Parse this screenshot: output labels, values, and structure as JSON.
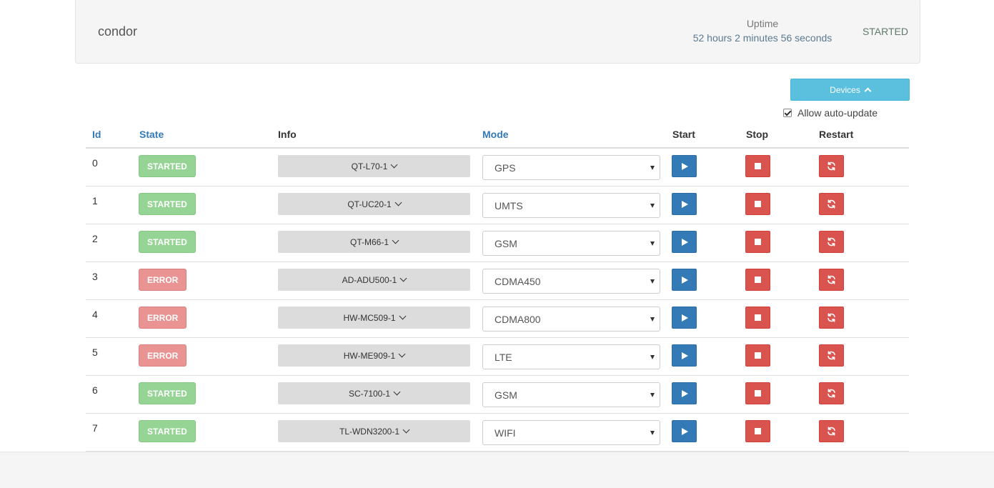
{
  "header": {
    "name": "condor",
    "uptime_label": "Uptime",
    "uptime_value": "52 hours 2 minutes 56 seconds",
    "status": "STARTED"
  },
  "controls": {
    "devices_label": "Devices",
    "auto_update_label": "Allow auto-update",
    "auto_update_checked": true
  },
  "table": {
    "columns": [
      "Id",
      "State",
      "Info",
      "Mode",
      "Start",
      "Stop",
      "Restart"
    ],
    "rows": [
      {
        "id": "0",
        "state": "STARTED",
        "info": "QT-L70-1",
        "mode": "GPS"
      },
      {
        "id": "1",
        "state": "STARTED",
        "info": "QT-UC20-1",
        "mode": "UMTS"
      },
      {
        "id": "2",
        "state": "STARTED",
        "info": "QT-M66-1",
        "mode": "GSM"
      },
      {
        "id": "3",
        "state": "ERROR",
        "info": "AD-ADU500-1",
        "mode": "CDMA450"
      },
      {
        "id": "4",
        "state": "ERROR",
        "info": "HW-MC509-1",
        "mode": "CDMA800"
      },
      {
        "id": "5",
        "state": "ERROR",
        "info": "HW-ME909-1",
        "mode": "LTE"
      },
      {
        "id": "6",
        "state": "STARTED",
        "info": "SC-7100-1",
        "mode": "GSM"
      },
      {
        "id": "7",
        "state": "STARTED",
        "info": "TL-WDN3200-1",
        "mode": "WIFI"
      }
    ]
  },
  "colors": {
    "started": "#95d495",
    "error": "#e99393",
    "primary": "#337ab7",
    "danger": "#d9534f",
    "info": "#5bc0de"
  },
  "icons": {
    "start": "play-icon",
    "stop": "stop-icon",
    "restart": "refresh-icon",
    "info_toggle": "chevron-down-icon",
    "devices_toggle": "chevron-up-icon"
  }
}
